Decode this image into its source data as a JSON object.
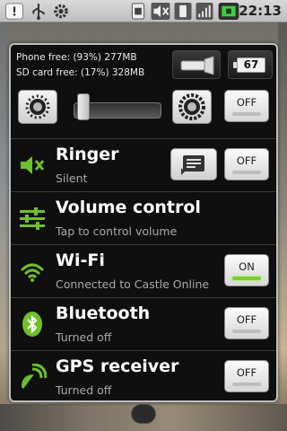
{
  "status_bar": {
    "time": "22:13",
    "icons": [
      "usb-icon",
      "usb-debug-icon",
      "settings-icon",
      "sim-icon",
      "mute-icon",
      "vibrate-icon",
      "signal-icon",
      "battery-charging-icon"
    ]
  },
  "panel": {
    "phone_free": "Phone free: (93%) 277MB",
    "sd_free": "SD card free: (17%) 328MB",
    "battery_level": "67",
    "brightness_level": 0.05,
    "rows": [
      {
        "title": "Ringer",
        "subtitle": "Silent",
        "toggle": "OFF",
        "state": "off"
      },
      {
        "title": "Volume control",
        "subtitle": "Tap to control volume"
      },
      {
        "title": "Wi-Fi",
        "subtitle": "Connected to Castle Online",
        "toggle": "ON",
        "state": "on"
      },
      {
        "title": "Bluetooth",
        "subtitle": "Turned off",
        "toggle": "OFF",
        "state": "off"
      },
      {
        "title": "GPS receiver",
        "subtitle": "Turned off",
        "toggle": "OFF",
        "state": "off"
      }
    ],
    "brightness_toggle": "OFF"
  },
  "colors": {
    "accent_green": "#7bd02a",
    "panel_bg": "#0f0f0f"
  }
}
